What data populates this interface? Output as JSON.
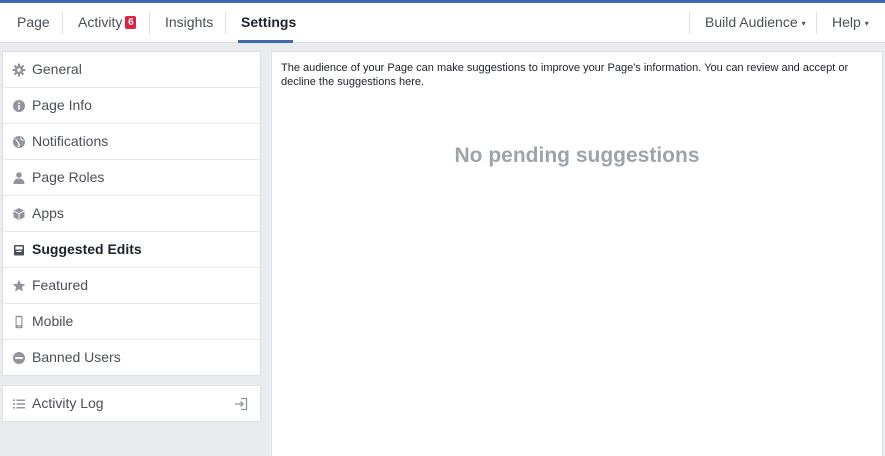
{
  "nav": {
    "tabs": [
      {
        "label": "Page"
      },
      {
        "label": "Activity",
        "badge": "6"
      },
      {
        "label": "Insights"
      },
      {
        "label": "Settings",
        "active": true
      }
    ],
    "right": [
      {
        "label": "Build Audience",
        "caret": "▾"
      },
      {
        "label": "Help",
        "caret": "▾"
      }
    ],
    "accent_color": "#4267b2",
    "badge_color": "#e41e3f"
  },
  "sidebar": {
    "items": [
      {
        "label": "General",
        "icon": "gear-icon"
      },
      {
        "label": "Page Info",
        "icon": "info-icon"
      },
      {
        "label": "Notifications",
        "icon": "globe-icon"
      },
      {
        "label": "Page Roles",
        "icon": "person-icon"
      },
      {
        "label": "Apps",
        "icon": "cube-icon"
      },
      {
        "label": "Suggested Edits",
        "icon": "inbox-icon",
        "active": true
      },
      {
        "label": "Featured",
        "icon": "star-icon"
      },
      {
        "label": "Mobile",
        "icon": "mobile-icon"
      },
      {
        "label": "Banned Users",
        "icon": "banned-icon"
      }
    ],
    "activity_log": {
      "label": "Activity Log",
      "icon": "list-icon",
      "action_icon": "exit-icon"
    }
  },
  "main": {
    "description": "The audience of your Page can make suggestions to improve your Page's information. You can review and accept or decline the suggestions here.",
    "empty_message": "No pending suggestions"
  }
}
